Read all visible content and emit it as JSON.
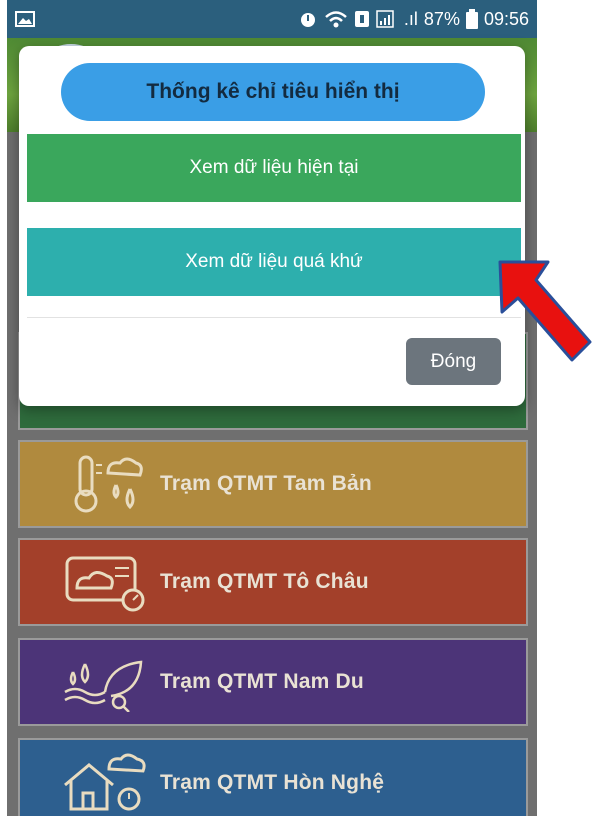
{
  "status_bar": {
    "battery": "87%",
    "time": "09:56",
    "icons": [
      "image-icon",
      "alarm-icon",
      "wifi-icon",
      "sim-icon",
      "signal-icon",
      "battery-icon"
    ]
  },
  "dialog": {
    "title": "Thống kê chỉ tiêu hiển thị",
    "option_current": "Xem dữ liệu hiện tại",
    "option_past": "Xem dữ liệu quá khứ",
    "close_label": "Đóng"
  },
  "stations": [
    {
      "label": "Trạm QTMT Tam Bản",
      "color": "#b08a3e",
      "icon": "thermometer-rain-icon"
    },
    {
      "label": "Trạm QTMT Tô Châu",
      "color": "#a3402a",
      "icon": "weather-gauge-icon"
    },
    {
      "label": "Trạm QTMT Nam Du",
      "color": "#4c3478",
      "icon": "water-leaf-icon"
    },
    {
      "label": "Trạm QTMT Hòn Nghệ",
      "color": "#2d5f8f",
      "icon": "house-weather-icon"
    }
  ],
  "colors": {
    "title_pill": "#3a9ee6",
    "current_btn": "#3aa75c",
    "past_btn": "#2dafad",
    "close_btn": "#6c757d",
    "annotation_arrow": "#e8110f"
  }
}
